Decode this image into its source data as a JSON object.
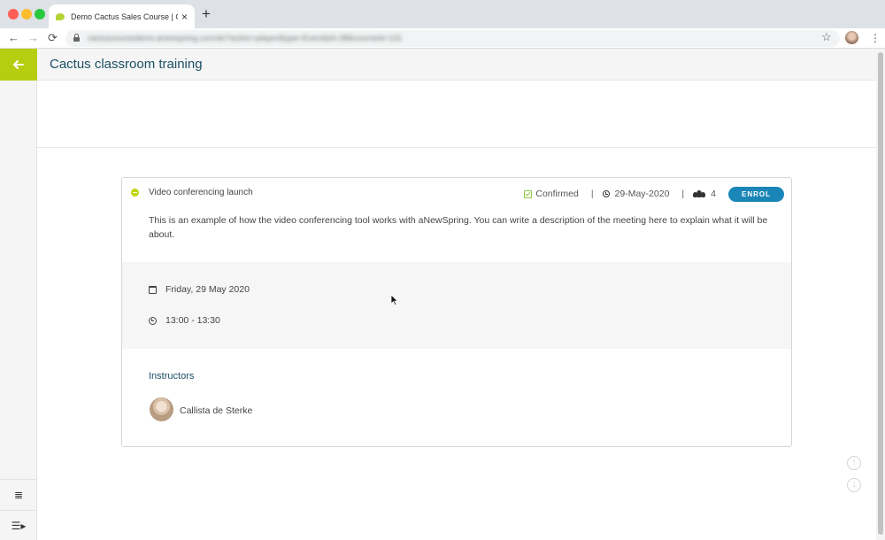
{
  "browser": {
    "tab_title": "Demo Cactus Sales Course | C",
    "tab_close": "×",
    "new_tab": "+",
    "url": "cactuscoursedemo.anewspring.com/do?action=player&type=Event&id=38&courseId=131",
    "nav": {
      "back": "←",
      "forward": "→",
      "reload": "⟳"
    },
    "star": "☆",
    "menu": "⋮"
  },
  "app": {
    "title": "Cactus classroom training",
    "accent_color": "#b7cd0f",
    "button_color": "#1a86b8"
  },
  "event": {
    "name": "Video conferencing launch",
    "status": "Confirmed",
    "separator": "|",
    "date_short": "29-May-2020",
    "participants": "4",
    "enrol_label": "ENROL",
    "description": "This is an example of how the video conferencing tool works with aNewSpring. You can write a description of the meeting here to explain what it will be about.",
    "date_long": "Friday, 29 May 2020",
    "time_range": "13:00 - 13:30"
  },
  "instructors": {
    "heading": "Instructors",
    "items": [
      {
        "name": "Callista de Sterke"
      }
    ]
  },
  "rail": {
    "notes_icon": "≣",
    "menu_icon": "☰▸"
  },
  "floating": {
    "up": "↑",
    "down": "↓"
  }
}
